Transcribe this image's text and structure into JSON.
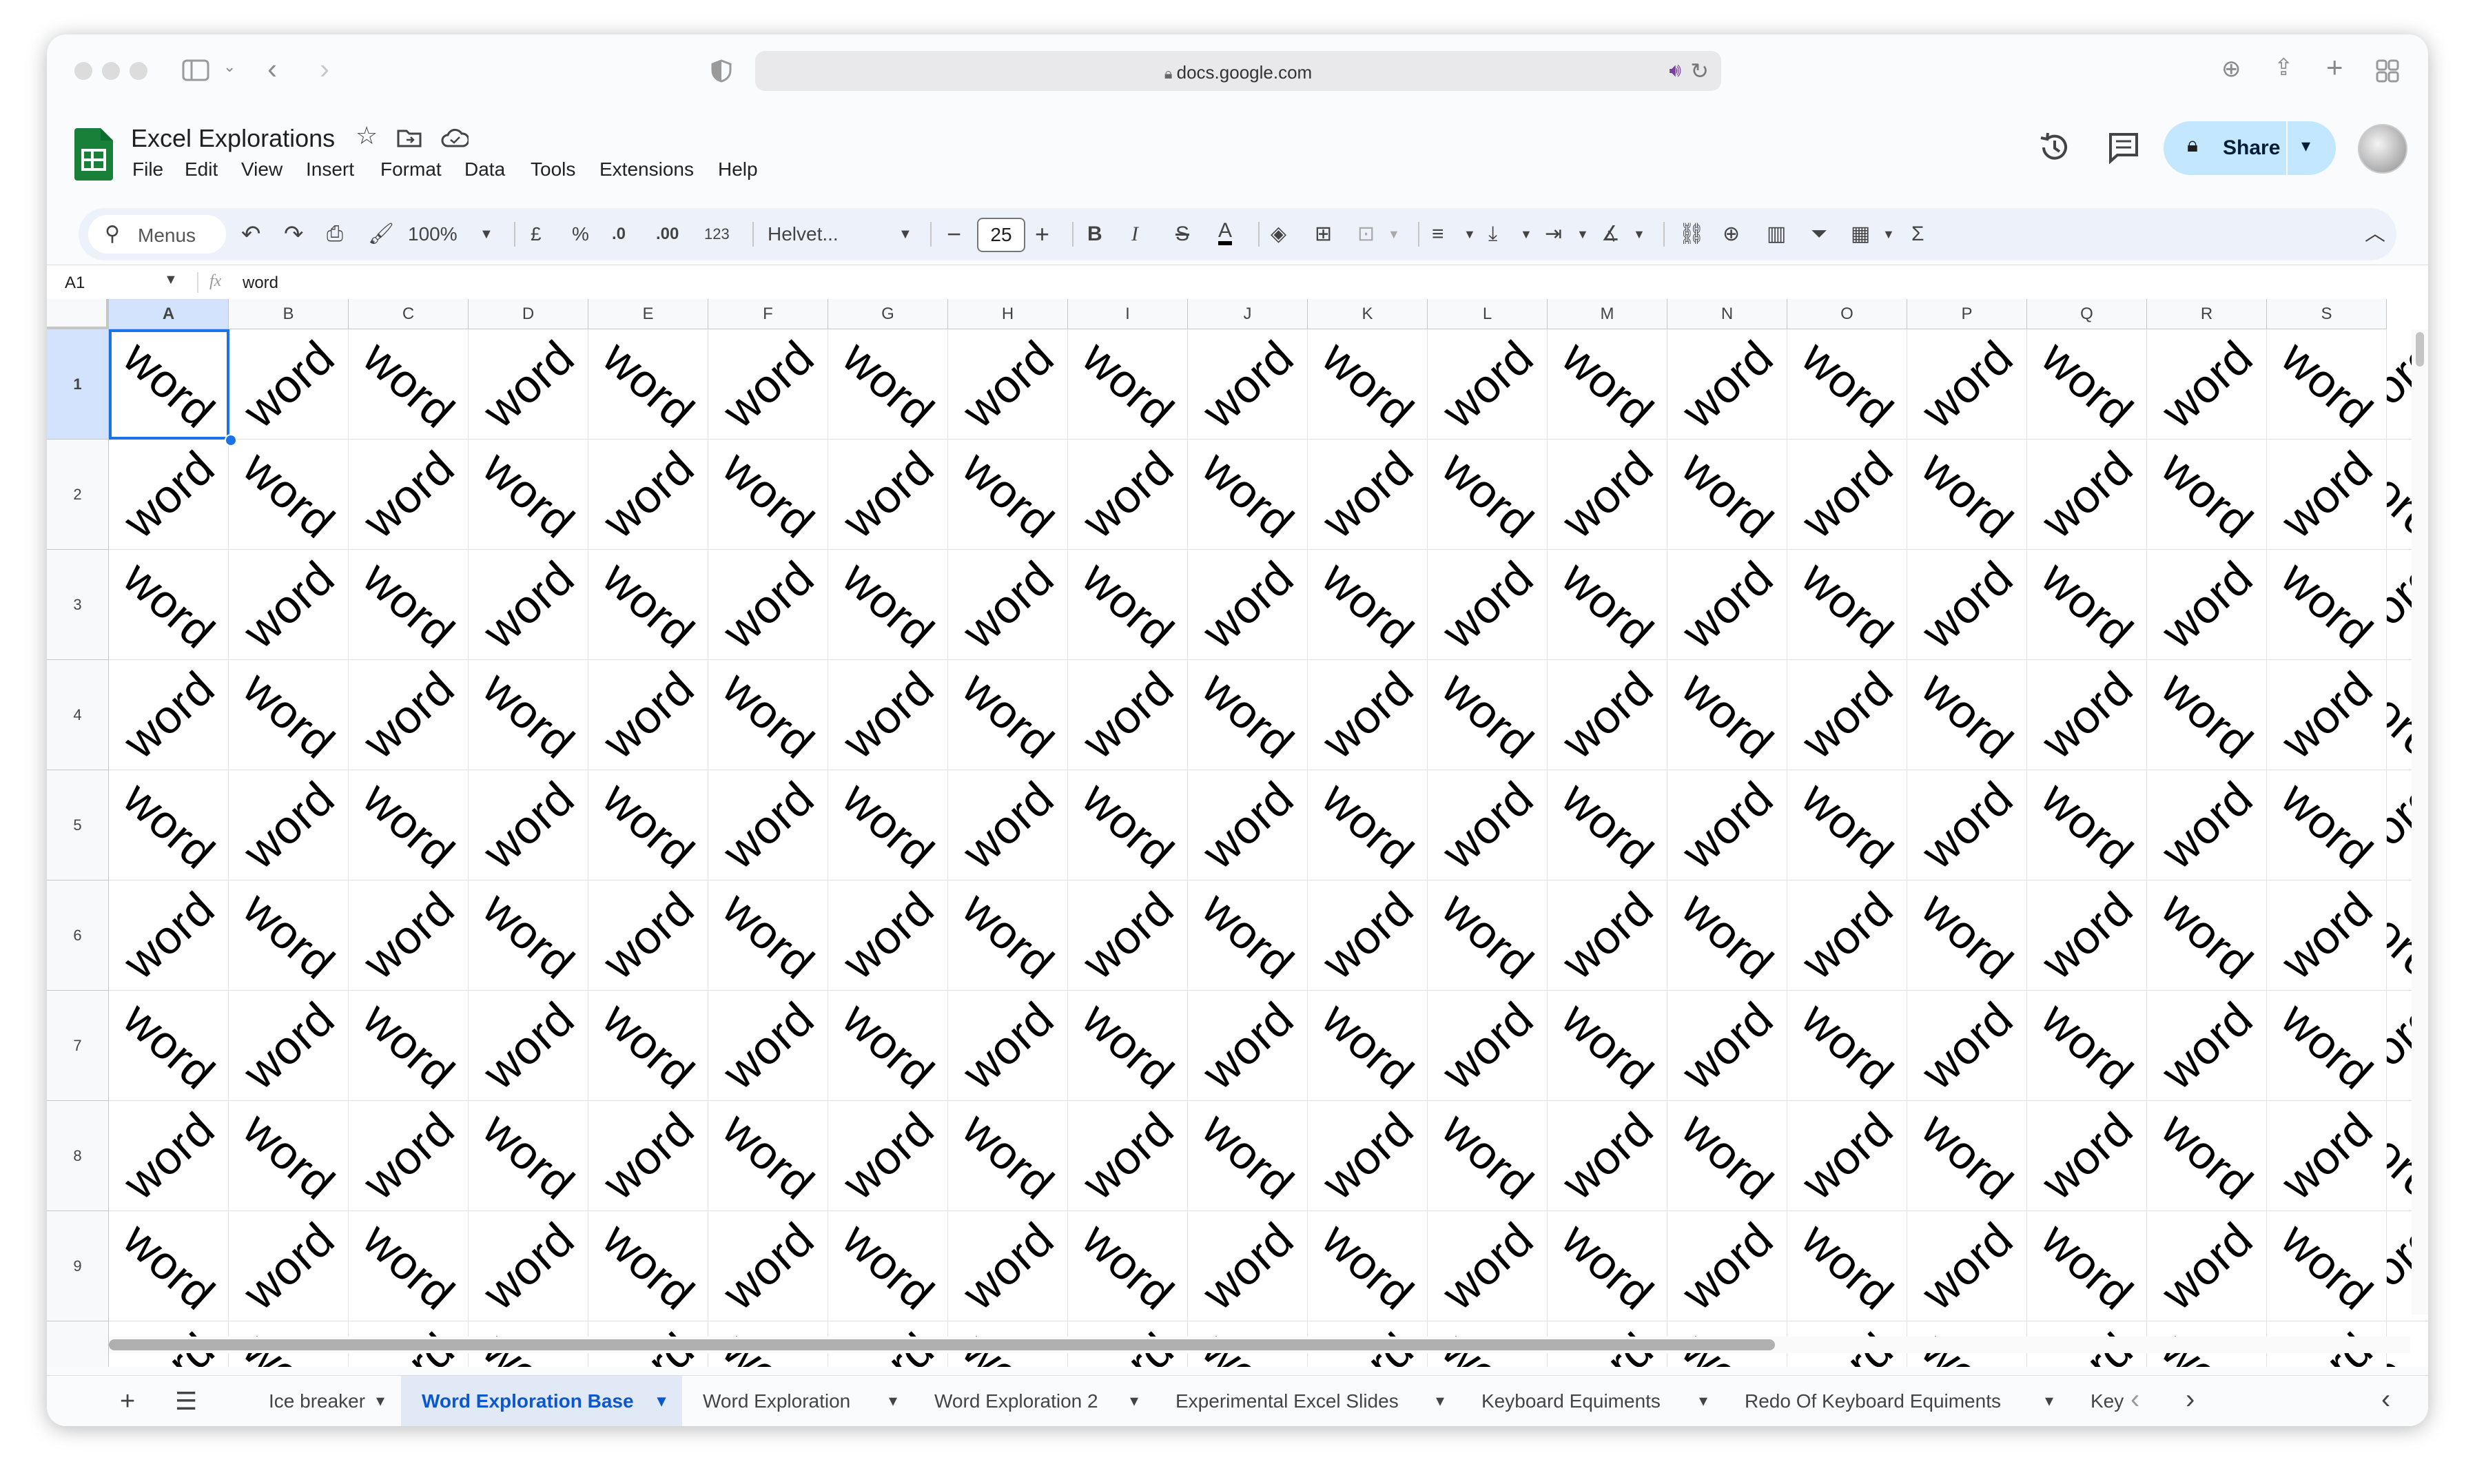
{
  "browser": {
    "url": "docs.google.com"
  },
  "doc": {
    "title": "Excel Explorations",
    "share_label": "Share"
  },
  "menu": [
    "File",
    "Edit",
    "View",
    "Insert",
    "Format",
    "Data",
    "Tools",
    "Extensions",
    "Help"
  ],
  "toolbar": {
    "search": "Menus",
    "zoom": "100%",
    "currency": "£",
    "percent": "%",
    "dec_less": ".0",
    "dec_more": ".00",
    "number_format": "123",
    "font": "Helvet...",
    "font_size": "25",
    "bold": "B",
    "italic": "I",
    "strike": "S",
    "text_color": "A",
    "sum": "Σ"
  },
  "formula_bar": {
    "cell_ref": "A1",
    "fx": "fx",
    "value": "word"
  },
  "columns": [
    "A",
    "B",
    "C",
    "D",
    "E",
    "F",
    "G",
    "H",
    "I",
    "J",
    "K",
    "L",
    "M",
    "N",
    "O",
    "P",
    "Q",
    "R",
    "S"
  ],
  "rows": [
    "1",
    "2",
    "3",
    "4",
    "5",
    "6",
    "7",
    "8",
    "9"
  ],
  "cell_text": "word",
  "sheets": {
    "tabs": [
      {
        "label": "Ice breaker",
        "active": false
      },
      {
        "label": "Word Exploration Base",
        "active": true
      },
      {
        "label": "Word Exploration",
        "active": false
      },
      {
        "label": "Word Exploration 2",
        "active": false
      },
      {
        "label": "Experimental Excel Slides",
        "active": false
      },
      {
        "label": "Keyboard Equiments",
        "active": false
      },
      {
        "label": "Redo Of Keyboard Equiments",
        "active": false
      },
      {
        "label": "Key",
        "active": false
      }
    ]
  },
  "colors": {
    "accent": "#0b57d0",
    "share_bg": "#c2e7ff",
    "sheets_green": "#188038"
  }
}
